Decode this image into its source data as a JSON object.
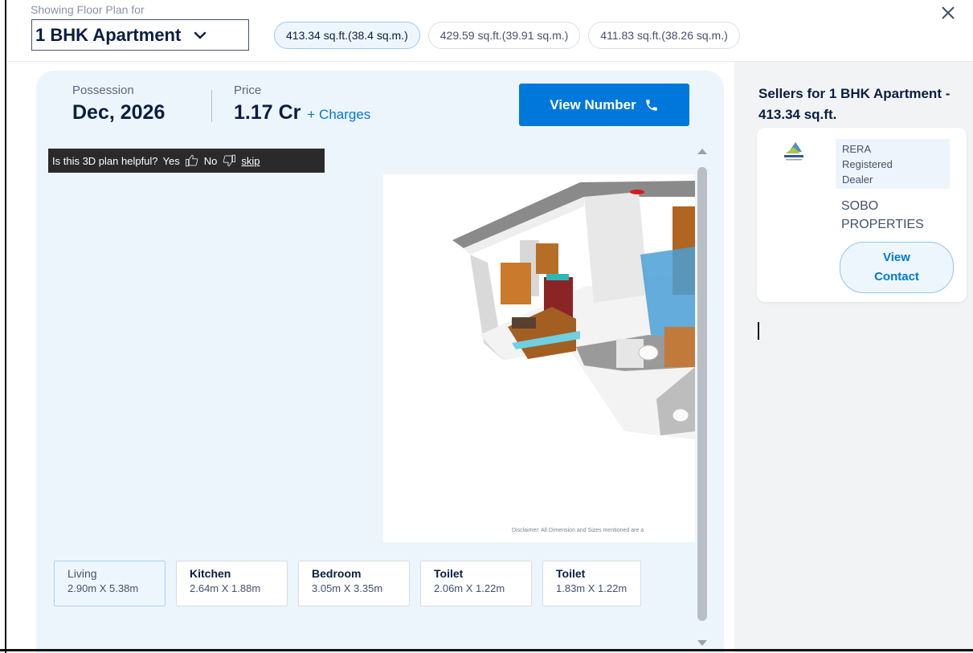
{
  "header": {
    "showing_label": "Showing Floor Plan for",
    "selected_config": "1 BHK Apartment",
    "size_options": [
      {
        "label": "413.34 sq.ft.(38.4 sq.m.)",
        "selected": true
      },
      {
        "label": "429.59 sq.ft.(39.91 sq.m.)",
        "selected": false
      },
      {
        "label": "411.83 sq.ft.(38.26 sq.m.)",
        "selected": false
      }
    ]
  },
  "plan": {
    "possession_label": "Possession",
    "possession_value": "Dec, 2026",
    "price_label": "Price",
    "price_value": "1.17 Cr",
    "charges_link": "+ Charges",
    "view_number_label": "View Number",
    "feedback": {
      "question": "Is this 3D plan helpful?",
      "yes": "Yes",
      "no": "No",
      "skip": "skip"
    },
    "disclaimer": "Disclaimer: All Dimension and Sizes mentioned are a",
    "rooms": [
      {
        "name": "Living",
        "dim": "2.90m X 5.38m",
        "active": true
      },
      {
        "name": "Kitchen",
        "dim": "2.64m X 1.88m",
        "active": false
      },
      {
        "name": "Bedroom",
        "dim": "3.05m X 3.35m",
        "active": false
      },
      {
        "name": "Toilet",
        "dim": "2.06m X 1.22m",
        "active": false
      },
      {
        "name": "Toilet",
        "dim": "1.83m X 1.22m",
        "active": false
      }
    ]
  },
  "sellers": {
    "title": "Sellers for 1 BHK Apartment - 413.34 sq.ft.",
    "card": {
      "badge_line1": "RERA",
      "badge_line2": "Registered",
      "badge_line3": "Dealer",
      "name_line1": "SOBO",
      "name_line2": "PROPERTIES",
      "view_contact_label": "View Contact"
    }
  },
  "colors": {
    "primary": "#0078db",
    "panel_bg": "#edf5fc",
    "text_dark": "#091E42"
  },
  "icons": {
    "dropdown": "chevron-down-icon",
    "close": "close-icon",
    "phone": "phone-icon",
    "thumbs_up": "thumbs-up-icon",
    "thumbs_down": "thumbs-down-icon"
  }
}
